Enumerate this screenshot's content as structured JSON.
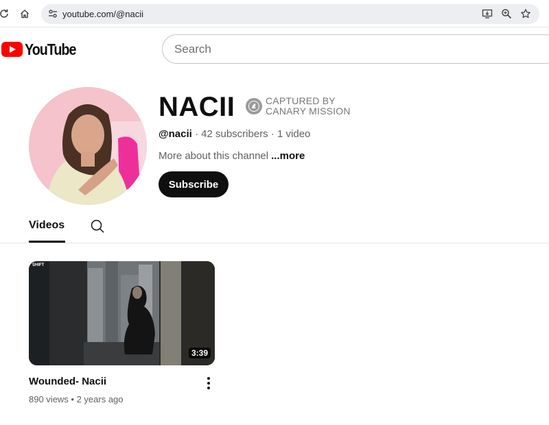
{
  "browser": {
    "url": "youtube.com/@nacii",
    "icons": [
      "reload-icon",
      "home-icon",
      "site-settings-icon",
      "install-app-icon",
      "zoom-icon",
      "bookmark-star-icon"
    ]
  },
  "header": {
    "logo_text": "YouTube",
    "brand_color": "#ff0000",
    "search_placeholder": "Search"
  },
  "channel": {
    "name": "NACII",
    "badge_line1": "CAPTURED BY",
    "badge_line2": "CANARY MISSION",
    "handle": "@nacii",
    "stats": " · 42 subscribers · 1 video",
    "about": "More about this channel",
    "about_more": "...more",
    "subscribe_label": "Subscribe"
  },
  "tabs": {
    "videos_label": "Videos",
    "search_icon": "search-icon"
  },
  "videos": [
    {
      "title": "Wounded- Nacii",
      "meta": "890 views • 2 years ago",
      "duration": "3:39",
      "thumb_tag": "SHIFT"
    }
  ]
}
